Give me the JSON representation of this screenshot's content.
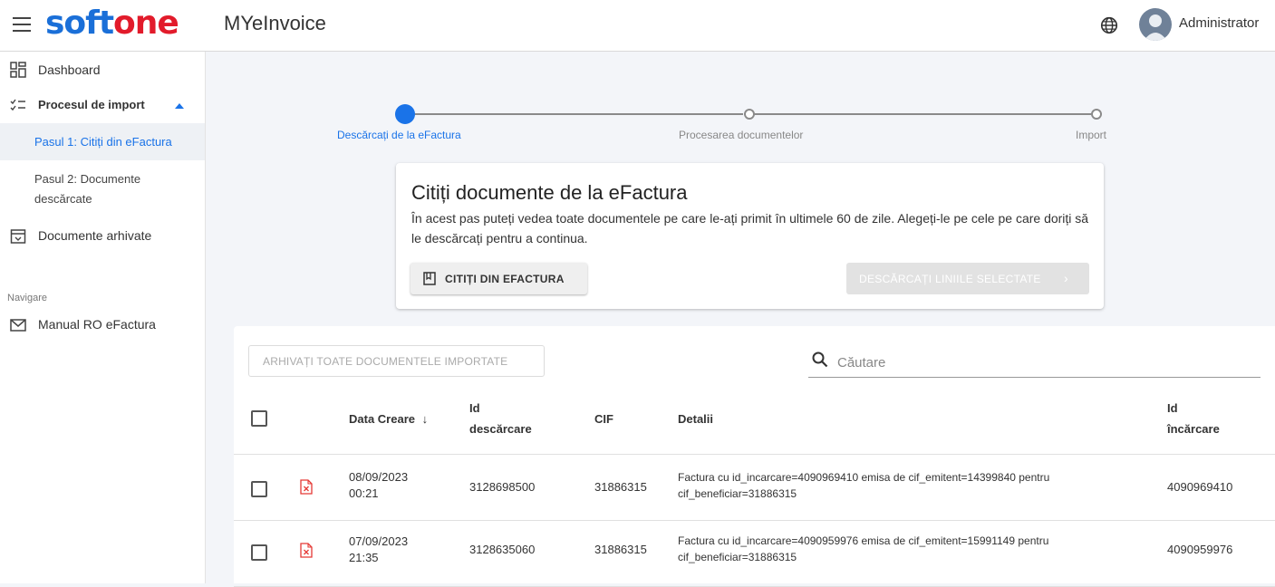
{
  "header": {
    "logo_part1": "soft",
    "logo_part2": "one",
    "app_name": "MYeInvoice",
    "user_name": "Administrator",
    "icons": [
      "menu-icon",
      "globe-icon",
      "avatar-icon"
    ]
  },
  "sidebar": {
    "dashboard": "Dashboard",
    "import_process": "Procesul de import",
    "step1": "Pasul 1: Citiți din eFactura",
    "step2_line1": "Pasul 2: Documente",
    "step2_line2": "descărcate",
    "archived": "Documente arhivate",
    "nav_section": "Navigare",
    "manual": "Manual RO eFactura"
  },
  "stepper": {
    "step1": "Descărcați de la eFactura",
    "step2": "Procesarea documentelor",
    "step3": "Import"
  },
  "card": {
    "title": "Citiți documente de la eFactura",
    "description": "În acest pas puteți vedea toate documentele pe care le-ați primit în ultimele 60 de zile. Alegeți-le pe cele pe care doriți să le descărcați pentru a continua.",
    "read_button": "CITIȚI DIN EFACTURA",
    "download_button": "DESCĂRCAȚI LINIILE SELECTATE"
  },
  "table": {
    "archive_button": "ARHIVAȚI TOATE DOCUMENTELE IMPORTATE",
    "search_placeholder": "Căutare",
    "columns": {
      "date": "Data Creare",
      "download_id_1": "Id",
      "download_id_2": "descărcare",
      "cif": "CIF",
      "details": "Detalii",
      "upload_id_1": "Id",
      "upload_id_2": "încărcare"
    },
    "rows": [
      {
        "date": "08/09/2023",
        "time": "00:21",
        "download_id": "3128698500",
        "cif": "31886315",
        "details_1": "Factura cu id_incarcare=4090969410 emisa de cif_emitent=14399840 pentru",
        "details_2": "cif_beneficiar=31886315",
        "upload_id": "4090969410"
      },
      {
        "date": "07/09/2023",
        "time": "21:35",
        "download_id": "3128635060",
        "cif": "31886315",
        "details_1": "Factura cu id_incarcare=4090959976 emisa de cif_emitent=15991149 pentru",
        "details_2": "cif_beneficiar=31886315",
        "upload_id": "4090959976"
      }
    ]
  },
  "colors": {
    "brand_blue": "#1a6fd8",
    "brand_red": "#e21b2b",
    "accent": "#1a73e8",
    "pdf_red": "#e53935"
  }
}
